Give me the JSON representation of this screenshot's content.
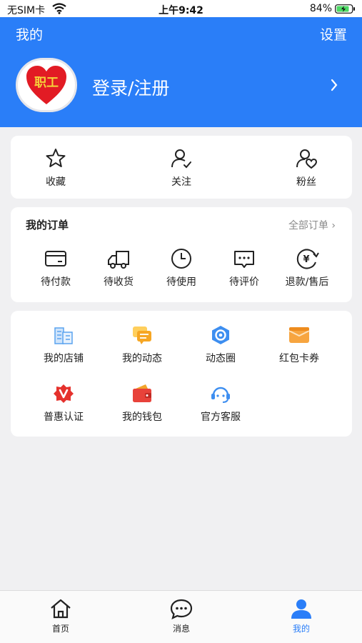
{
  "status_bar": {
    "carrier": "无SIM卡",
    "time": "上午9:42",
    "battery": "84%"
  },
  "header": {
    "title": "我的",
    "settings": "设置",
    "login": "登录/注册",
    "avatar_text": "职工"
  },
  "favorites": [
    {
      "label": "收藏",
      "icon": "star-icon"
    },
    {
      "label": "关注",
      "icon": "user-check-icon"
    },
    {
      "label": "粉丝",
      "icon": "user-heart-icon"
    }
  ],
  "orders": {
    "title": "我的订单",
    "all": "全部订单 ›",
    "items": [
      {
        "label": "待付款",
        "icon": "card-icon"
      },
      {
        "label": "待收货",
        "icon": "truck-icon"
      },
      {
        "label": "待使用",
        "icon": "clock-icon"
      },
      {
        "label": "待评价",
        "icon": "comment-icon"
      },
      {
        "label": "退款/售后",
        "icon": "refund-icon"
      }
    ]
  },
  "services": [
    {
      "label": "我的店铺",
      "icon": "store-icon"
    },
    {
      "label": "我的动态",
      "icon": "message-icon"
    },
    {
      "label": "动态圈",
      "icon": "circle-icon"
    },
    {
      "label": "红包卡券",
      "icon": "coupon-icon"
    },
    {
      "label": "普惠认证",
      "icon": "verify-icon"
    },
    {
      "label": "我的钱包",
      "icon": "wallet-icon"
    },
    {
      "label": "官方客服",
      "icon": "service-icon"
    }
  ],
  "tabs": [
    {
      "label": "首页",
      "icon": "home-icon"
    },
    {
      "label": "消息",
      "icon": "chat-icon"
    },
    {
      "label": "我的",
      "icon": "person-icon"
    }
  ],
  "colors": {
    "brand": "#2a7ef8",
    "background": "#f0f0f2"
  }
}
